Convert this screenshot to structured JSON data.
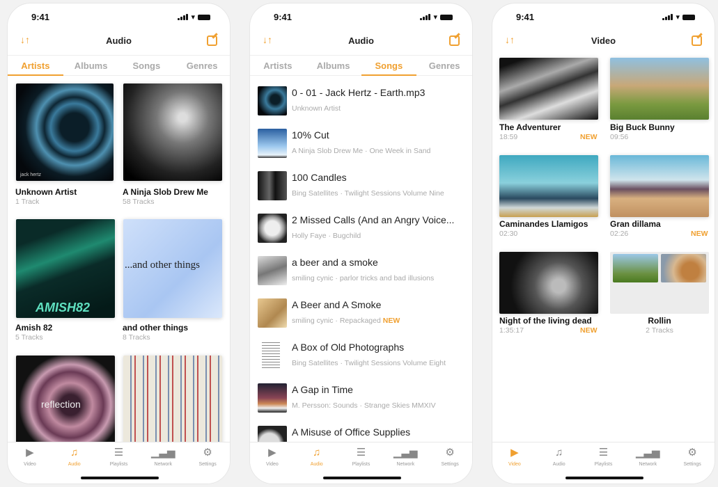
{
  "status": {
    "time": "9:41"
  },
  "accent": "#f0a030",
  "tabbar": [
    {
      "label": "Video",
      "icon": "play-icon"
    },
    {
      "label": "Audio",
      "icon": "music-note-icon"
    },
    {
      "label": "Playlists",
      "icon": "playlist-icon"
    },
    {
      "label": "Network",
      "icon": "network-icon"
    },
    {
      "label": "Settings",
      "icon": "gear-icon"
    }
  ],
  "screen1": {
    "title": "Audio",
    "tabs": [
      "Artists",
      "Albums",
      "Songs",
      "Genres"
    ],
    "active_tab": "Artists",
    "artists": [
      {
        "name": "Unknown Artist",
        "count": "1 Track",
        "art_text": "jack hertz"
      },
      {
        "name": "A Ninja Slob Drew Me",
        "count": "58 Tracks"
      },
      {
        "name": "Amish 82",
        "count": "5 Tracks",
        "art_text": "AMISH82"
      },
      {
        "name": "and other things",
        "count": "8 Tracks",
        "art_text": "...and other things"
      },
      {
        "name": "",
        "count": "",
        "art_text": "reflection"
      },
      {
        "name": "",
        "count": ""
      }
    ]
  },
  "screen2": {
    "title": "Audio",
    "tabs": [
      "Artists",
      "Albums",
      "Songs",
      "Genres"
    ],
    "active_tab": "Songs",
    "songs": [
      {
        "title": "0 - 01 - Jack Hertz - Earth.mp3",
        "subtitle": "Unknown Artist",
        "new": ""
      },
      {
        "title": "10% Cut",
        "subtitle": "A Ninja Slob Drew Me · One Week in Sand",
        "new": ""
      },
      {
        "title": "100 Candles",
        "subtitle": "Bing Satellites · Twilight Sessions Volume Nine",
        "new": ""
      },
      {
        "title": "2 Missed Calls (And an Angry Voice...",
        "subtitle": "Holly Faye · Bugchild",
        "new": ""
      },
      {
        "title": "a beer and a smoke",
        "subtitle": "smiling cynic · parlor tricks and bad illusions",
        "new": ""
      },
      {
        "title": "A Beer and A Smoke",
        "subtitle": "smiling cynic · Repackaged",
        "new": "NEW"
      },
      {
        "title": "A Box of Old Photographs",
        "subtitle": "Bing Satellites · Twilight Sessions Volume Eight",
        "new": ""
      },
      {
        "title": "A Gap in Time",
        "subtitle": "M. Persson: Sounds · Strange Skies MMXIV",
        "new": ""
      },
      {
        "title": "A Misuse of Office Supplies",
        "subtitle": "",
        "new": ""
      }
    ]
  },
  "screen3": {
    "title": "Video",
    "videos": [
      {
        "title": "The Adventurer",
        "duration": "18:59",
        "new": "NEW"
      },
      {
        "title": "Big Buck Bunny",
        "duration": "09:56",
        "new": ""
      },
      {
        "title": "Caminandes Llamigos",
        "duration": "02:30",
        "new": ""
      },
      {
        "title": "Gran dillama",
        "duration": "02:26",
        "new": "NEW"
      },
      {
        "title": "Night of the living dead",
        "duration": "1:35:17",
        "new": "NEW"
      },
      {
        "title": "Rollin",
        "duration": "2 Tracks",
        "new": ""
      }
    ]
  }
}
